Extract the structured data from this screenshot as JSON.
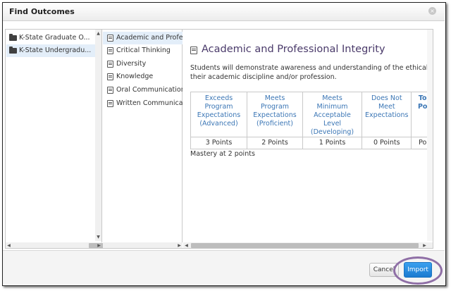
{
  "dialog": {
    "title": "Find Outcomes",
    "close_glyph": "×"
  },
  "groups": [
    {
      "label": "K-State Graduate O...",
      "icon": "folder-icon",
      "selected": false
    },
    {
      "label": "K-State Undergradu...",
      "icon": "folder-icon",
      "selected": true
    }
  ],
  "outcomes": [
    {
      "label": "Academic and Profe...",
      "icon": "outcome-icon",
      "selected": true
    },
    {
      "label": "Critical Thinking",
      "icon": "outcome-icon",
      "selected": false
    },
    {
      "label": "Diversity",
      "icon": "outcome-icon",
      "selected": false
    },
    {
      "label": "Knowledge",
      "icon": "outcome-icon",
      "selected": false
    },
    {
      "label": "Oral Communication",
      "icon": "outcome-icon",
      "selected": false
    },
    {
      "label": "Written Communicat...",
      "icon": "outcome-icon",
      "selected": false
    }
  ],
  "detail": {
    "title": "Academic and Professional Integrity",
    "description": "Students will demonstrate awareness and understanding of the ethical standards of their academic discipline and/or profession.",
    "ratings": [
      {
        "description": "Exceeds Program Expectations (Advanced)",
        "points": "3 Points"
      },
      {
        "description": "Meets Program Expectations (Proficient)",
        "points": "2 Points"
      },
      {
        "description": "Meets Minimum Acceptable Level (Developing)",
        "points": "1 Points"
      },
      {
        "description": "Does Not Meet Expectations",
        "points": "0 Points"
      },
      {
        "description": "To Po",
        "points": "Po"
      }
    ],
    "mastery": "Mastery at 2 points"
  },
  "buttons": {
    "cancel": "Cancel",
    "import": "Import"
  },
  "colors": {
    "link_blue": "#3b76b5",
    "heading_purple": "#4a3a6a",
    "import_blue": "#1b7ad0",
    "selection": "#e3eef9",
    "highlight_ring": "#8f6fa6"
  }
}
